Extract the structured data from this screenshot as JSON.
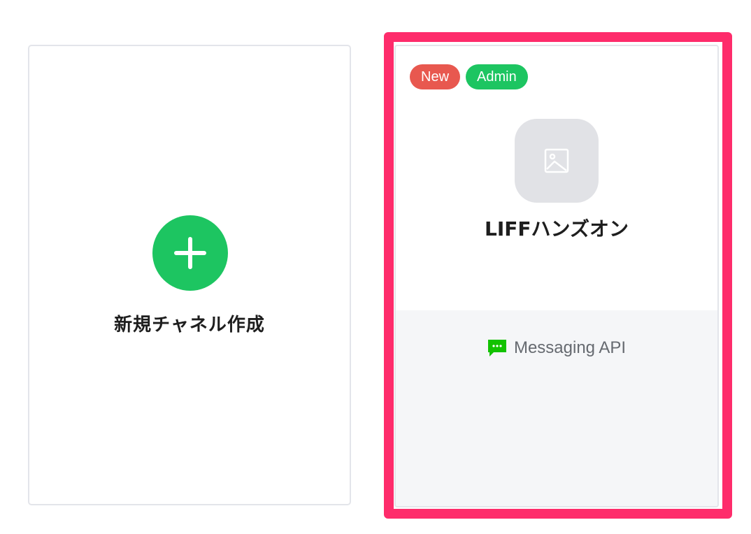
{
  "new_channel": {
    "label": "新規チャネル作成",
    "icon": "plus-icon",
    "accent_color": "#1dc561"
  },
  "channel": {
    "badges": [
      {
        "label": "New",
        "color": "#e8584f"
      },
      {
        "label": "Admin",
        "color": "#1dc561"
      }
    ],
    "icon": "image-placeholder-icon",
    "name": "LIFFハンズオン",
    "type_icon": "messaging-api-icon",
    "type_label": "Messaging API",
    "highlighted": true,
    "highlight_color": "#fe2c6b"
  }
}
